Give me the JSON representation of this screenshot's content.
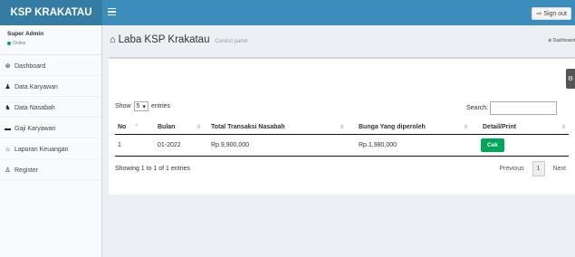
{
  "header": {
    "brand": "KSP KRAKATAU",
    "signout_label": "Sign out"
  },
  "sidebar": {
    "user": {
      "name": "Super Admin",
      "status": "Online"
    },
    "items": [
      {
        "label": "Dashboard",
        "icon": "dashboard-icon",
        "glyph": "⊛"
      },
      {
        "label": "Data Karyawan",
        "icon": "user-icon",
        "glyph": "♟"
      },
      {
        "label": "Data Nasabah",
        "icon": "users-icon",
        "glyph": "♞"
      },
      {
        "label": "Gaji Karyawan",
        "icon": "money-icon",
        "glyph": "▬"
      },
      {
        "label": "Laporan Keuangan",
        "icon": "bank-icon",
        "glyph": "⌂"
      },
      {
        "label": "Register",
        "icon": "user-plus-icon",
        "glyph": "♙"
      }
    ]
  },
  "page": {
    "title": "Laba KSP Krakatau",
    "subtitle": "Control panel",
    "breadcrumb": "Dashboard"
  },
  "table_controls": {
    "show_label": "Show",
    "entries_value": "5",
    "entries_label": "entries",
    "search_label": "Search:",
    "search_value": ""
  },
  "table": {
    "columns": [
      "No",
      "Bulan",
      "Total Transaksi Nasabah",
      "Bunga Yang diperoleh",
      "Detail/Print"
    ],
    "rows": [
      {
        "no": "1",
        "bulan": "01-2022",
        "total": "Rp.9,900,000",
        "bunga": "Rp.1,980,000",
        "action": "Cek"
      }
    ]
  },
  "footer": {
    "info": "Showing 1 to 1 of 1 entries",
    "previous": "Previous",
    "page": "1",
    "next": "Next"
  },
  "colors": {
    "header": "#3c8dbc",
    "logo": "#357ca5",
    "success": "#00a65a"
  }
}
